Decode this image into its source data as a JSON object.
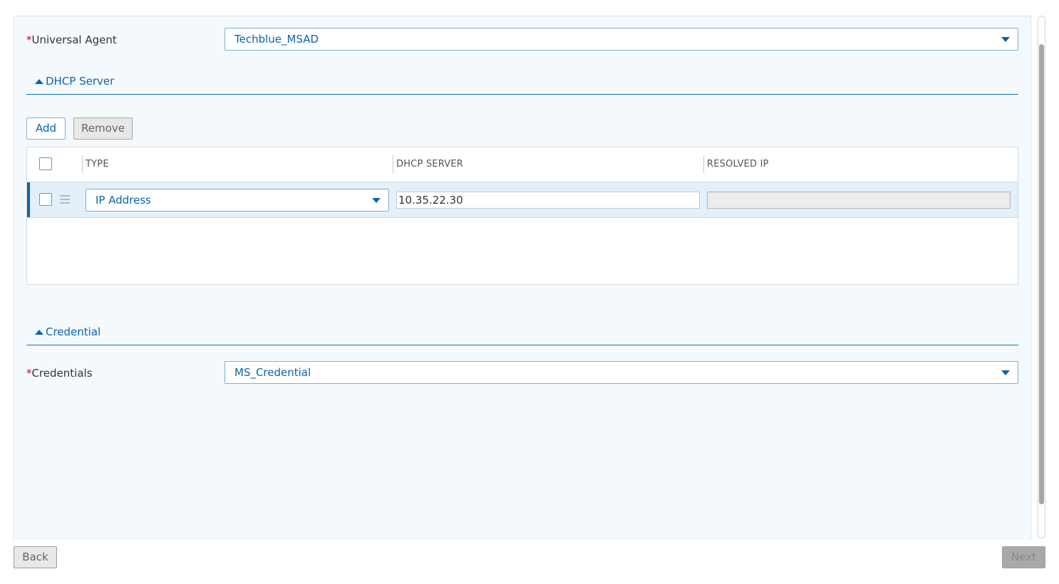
{
  "universal_agent": {
    "label": "Universal Agent",
    "required_mark": "*",
    "value": "Techblue_MSAD"
  },
  "dhcp_section": {
    "title": "DHCP Server",
    "add_label": "Add",
    "remove_label": "Remove",
    "table": {
      "columns": [
        "TYPE",
        "DHCP SERVER",
        "RESOLVED IP"
      ],
      "rows": [
        {
          "type": "IP Address",
          "dhcp_server": "10.35.22.30",
          "resolved_ip": ""
        }
      ]
    }
  },
  "credential_section": {
    "title": "Credential",
    "credentials": {
      "label": "Credentials",
      "required_mark": "*",
      "value": "MS_Credential"
    }
  },
  "footer": {
    "back_label": "Back",
    "next_label": "Next"
  },
  "icons": {
    "dropdown": "caret-down-icon",
    "section_toggle": "caret-up-icon",
    "drag": "drag-handle-icon"
  },
  "colors": {
    "accent": "#0b64ae",
    "required": "#d0021b",
    "panel_bg": "#f4f9fd"
  }
}
